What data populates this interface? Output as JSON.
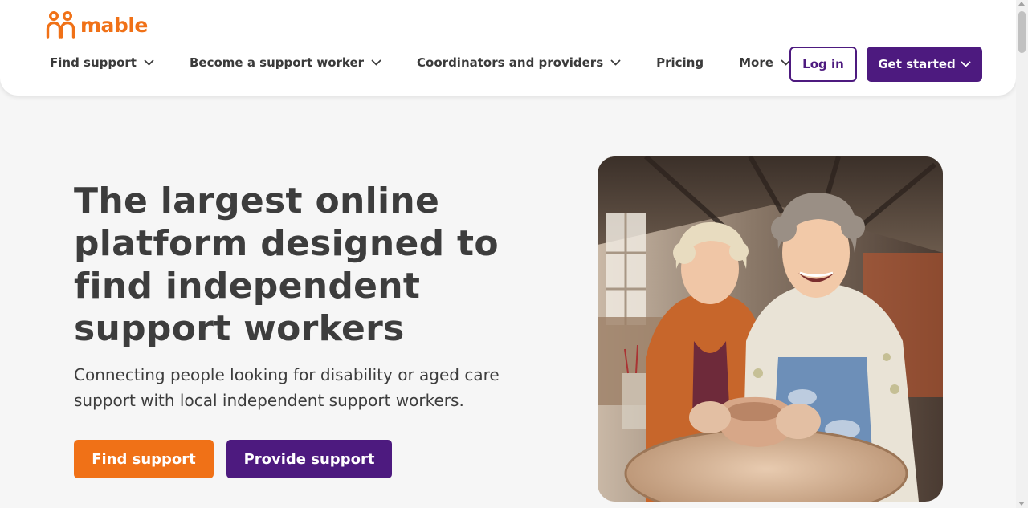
{
  "brand": {
    "name": "mable",
    "color": "#f07117",
    "secondary_color": "#4d1a7f"
  },
  "nav": {
    "items": [
      {
        "label": "Find support",
        "has_dropdown": true,
        "icon": "chevron-down-icon"
      },
      {
        "label": "Become a support worker",
        "has_dropdown": true,
        "icon": "chevron-down-icon"
      },
      {
        "label": "Coordinators and providers",
        "has_dropdown": true,
        "icon": "chevron-down-icon"
      },
      {
        "label": "Pricing",
        "has_dropdown": false
      },
      {
        "label": "More",
        "has_dropdown": true,
        "icon": "chevron-down-icon"
      }
    ],
    "login_label": "Log in",
    "get_started_label": "Get started"
  },
  "hero": {
    "title": "The largest online platform designed to find independent support workers",
    "subtitle": "Connecting people looking for disability or aged care support with local independent support workers.",
    "primary_cta": "Find support",
    "secondary_cta": "Provide support",
    "image": "two-women-pottery-photo"
  }
}
